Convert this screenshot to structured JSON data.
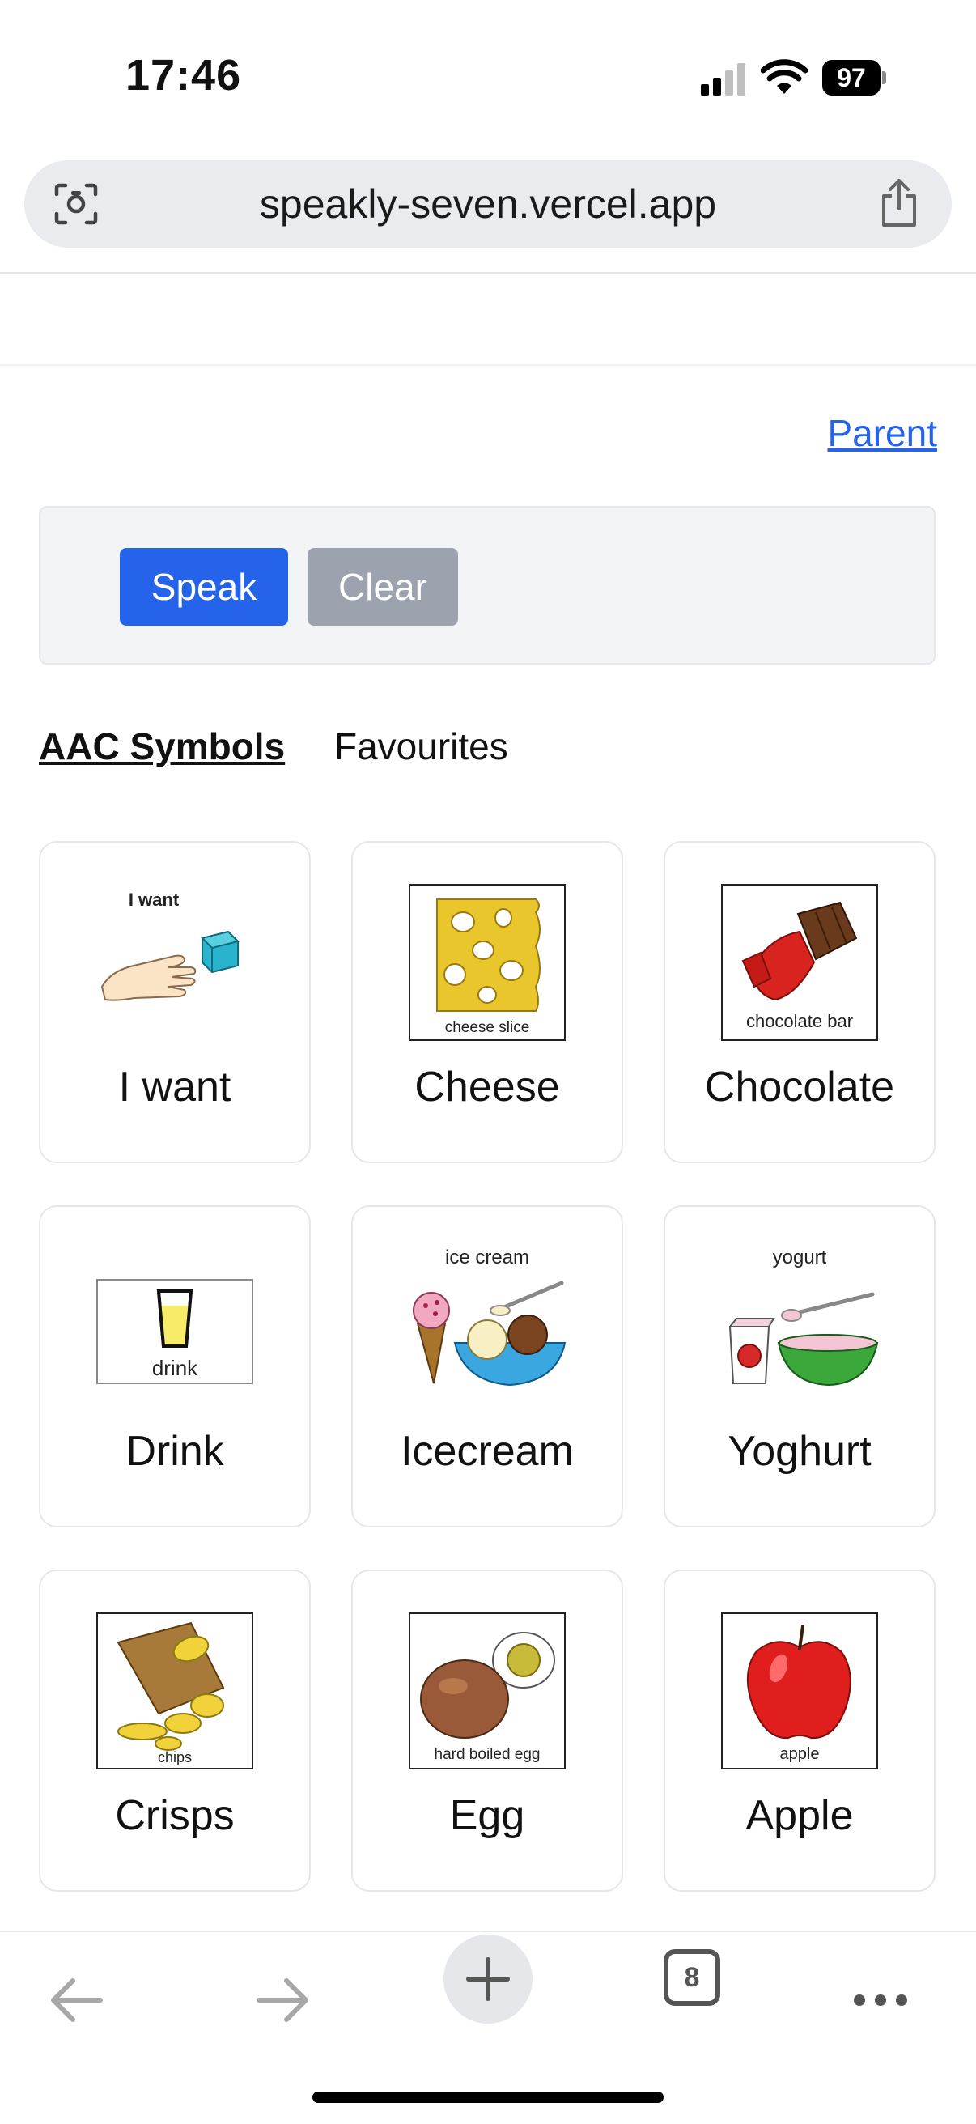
{
  "status": {
    "time": "17:46",
    "battery": "97"
  },
  "browser": {
    "url": "speakly-seven.vercel.app",
    "tab_count": "8"
  },
  "header": {
    "parent_link": "Parent"
  },
  "toolbar": {
    "speak_label": "Speak",
    "clear_label": "Clear"
  },
  "tabs": [
    {
      "label": "AAC Symbols",
      "active": true
    },
    {
      "label": "Favourites",
      "active": false
    }
  ],
  "symbols": [
    {
      "label": "I want",
      "caption": "I want"
    },
    {
      "label": "Cheese",
      "caption": "cheese slice"
    },
    {
      "label": "Chocolate",
      "caption": "chocolate bar"
    },
    {
      "label": "Drink",
      "caption": "drink"
    },
    {
      "label": "Icecream",
      "caption": "ice cream"
    },
    {
      "label": "Yoghurt",
      "caption": "yogurt"
    },
    {
      "label": "Crisps",
      "caption": "chips"
    },
    {
      "label": "Egg",
      "caption": "hard boiled egg"
    },
    {
      "label": "Apple",
      "caption": "apple"
    }
  ],
  "colors": {
    "accent": "#2563eb",
    "clear_button": "#9ca3af"
  }
}
